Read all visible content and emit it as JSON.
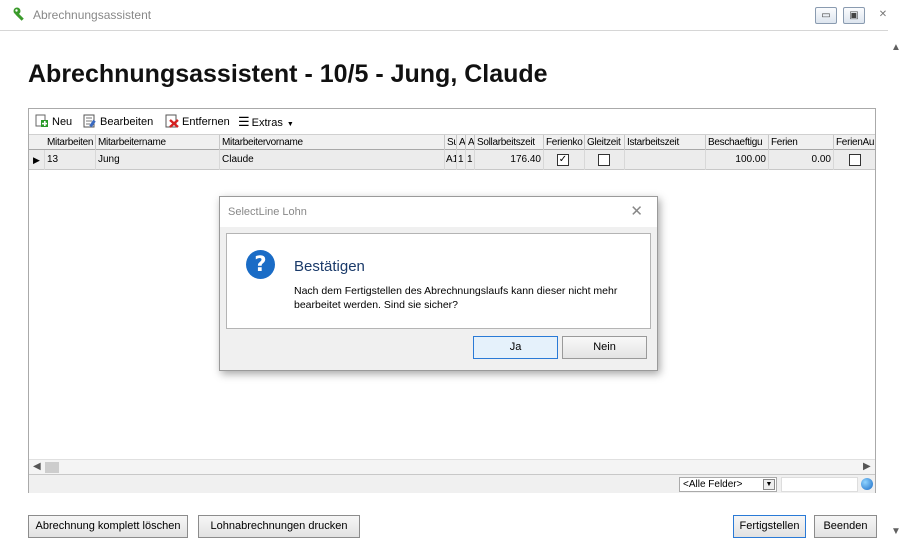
{
  "window": {
    "title": "Abrechnungsassistent",
    "minimize_label": "▭",
    "maximize_label": "▣",
    "close_label": "✕"
  },
  "heading": "Abrechnungsassistent - 10/5 - Jung, Claude",
  "toolbar": {
    "new_label": "Neu",
    "edit_label": "Bearbeiten",
    "remove_label": "Entfernen",
    "extras_label": "Extras"
  },
  "grid": {
    "columns": [
      "Mitarbeiten",
      "Mitarbeitername",
      "Mitarbeitervorname",
      "Su",
      "A",
      "A",
      "Sollarbeitszeit",
      "Ferienko",
      "Gleitzeit",
      "Istarbeitszeit",
      "Beschaeftigu",
      "Ferien",
      "FerienAu"
    ],
    "row": {
      "indicator": "▶",
      "nr": "13",
      "name": "Jung",
      "vorname": "Claude",
      "su": "A1",
      "a1": "1",
      "a2": "1",
      "soll": "176.40",
      "ferienko": true,
      "gleitzeit": false,
      "ist": "",
      "beschaeftigung": "100.00",
      "ferien": "0.00",
      "ferienau": false
    }
  },
  "statusbar": {
    "field_filter": "<Alle Felder>"
  },
  "buttons": {
    "delete_all": "Abrechnung komplett löschen",
    "print": "Lohnabrechnungen drucken",
    "finish": "Fertigstellen",
    "exit": "Beenden"
  },
  "dialog": {
    "title": "SelectLine Lohn",
    "heading": "Bestätigen",
    "message": "Nach dem Fertigstellen des Abrechnungslaufs kann dieser nicht mehr bearbeitet werden. Sind sie sicher?",
    "yes": "Ja",
    "no": "Nein",
    "close": "✕",
    "icon_glyph": "?"
  },
  "colors": {
    "accent": "#1a6cc6",
    "heading": "#1a3a6a"
  }
}
